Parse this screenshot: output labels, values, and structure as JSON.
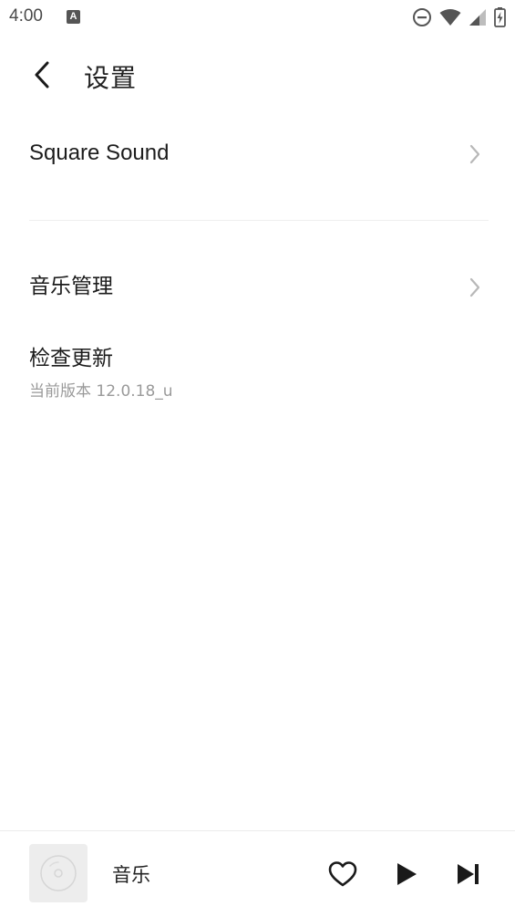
{
  "status_bar": {
    "time": "4:00",
    "notification_icon_letter": "A",
    "icons": [
      "dnd-icon",
      "wifi-icon",
      "signal-icon",
      "battery-charging-icon"
    ]
  },
  "header": {
    "title": "设置",
    "back_icon": "chevron-left-icon"
  },
  "settings": {
    "square_sound": {
      "label": "Square Sound"
    },
    "music_management": {
      "label": "音乐管理"
    },
    "check_update": {
      "label": "检查更新",
      "subtitle": "当前版本 12.0.18_u"
    }
  },
  "player": {
    "track_title": "音乐",
    "icons": [
      "album-art-disc-icon",
      "heart-icon",
      "play-icon",
      "skip-next-icon"
    ]
  },
  "colors": {
    "background": "#ffffff",
    "text_primary": "#1c1c1c",
    "text_secondary": "#9a9a9a",
    "chevron": "#b8b8b8",
    "divider": "#eeeeee",
    "album_bg": "#ededed"
  }
}
